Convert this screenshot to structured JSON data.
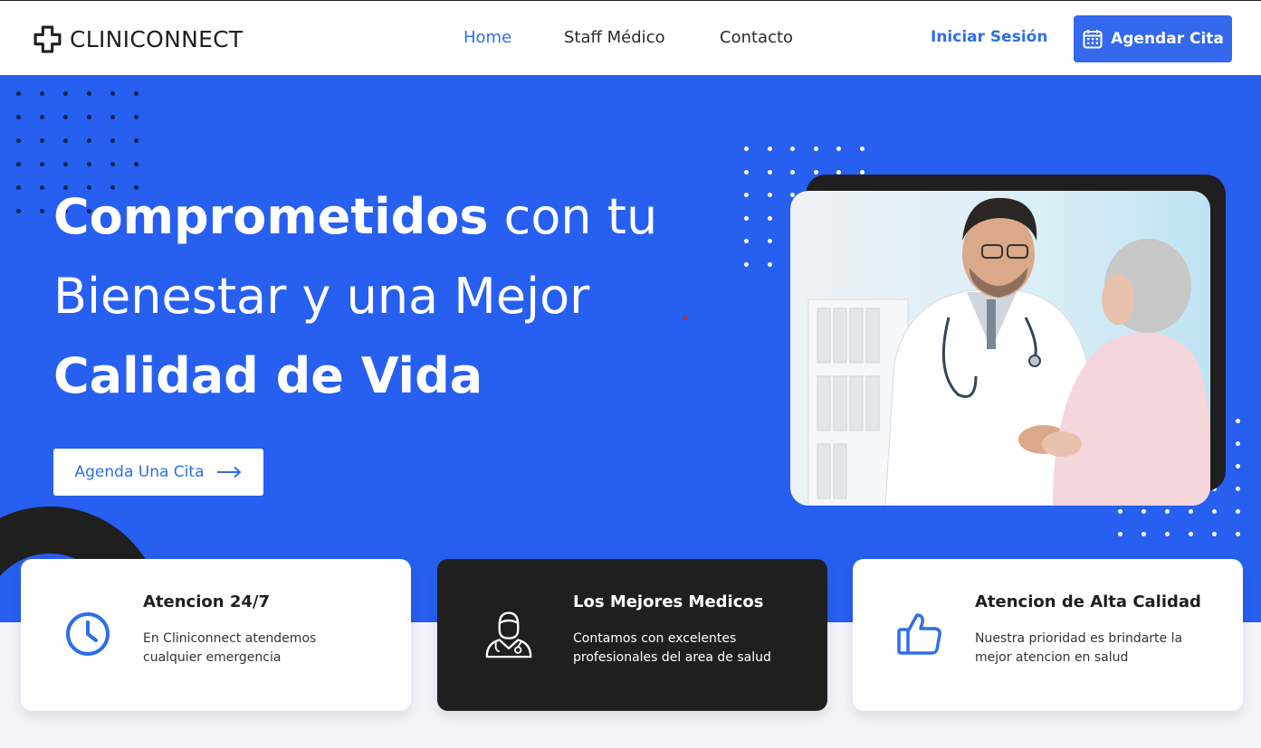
{
  "header": {
    "brand": "CLINICONNECT",
    "nav": [
      {
        "label": "Home"
      },
      {
        "label": "Staff Médico"
      },
      {
        "label": "Contacto"
      }
    ],
    "login_label": "Iniciar Sesión",
    "cta_label": "Agendar Cita"
  },
  "hero": {
    "line1_bold": "Comprometidos",
    "line1_rest": " con tu",
    "line2": "Bienestar y una Mejor",
    "line3": "Calidad de Vida",
    "button_label": "Agenda Una Cita"
  },
  "features": [
    {
      "title": "Atencion 24/7",
      "description": "En Cliniconnect atendemos cualquier emergencia",
      "icon": "clock-icon"
    },
    {
      "title": "Los Mejores Medicos",
      "description": "Contamos con excelentes profesionales del area de salud",
      "icon": "doctor-icon"
    },
    {
      "title": "Atencion de Alta Calidad",
      "description": "Nuestra prioridad es brindarte la mejor atencion en salud",
      "icon": "thumbs-up-icon"
    }
  ],
  "colors": {
    "primary": "#275ff0",
    "accent": "#2f6ee8",
    "dark": "#1f1f1f",
    "background": "#f4f3fa"
  }
}
